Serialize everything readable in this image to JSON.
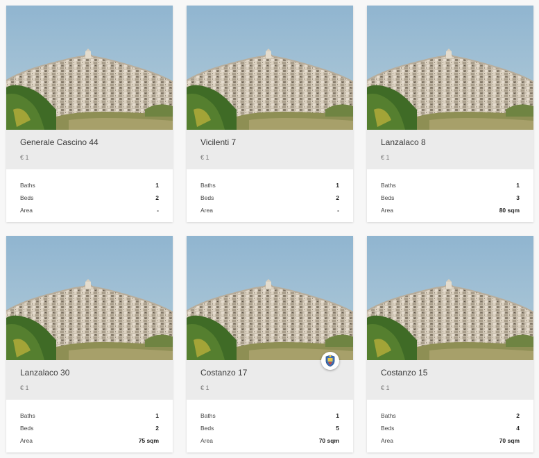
{
  "listings": [
    {
      "title": "Generale Cascino 44",
      "price": "€ 1",
      "baths_label": "Baths",
      "baths": "1",
      "beds_label": "Beds",
      "beds": "2",
      "area_label": "Area",
      "area": "-",
      "badge": false
    },
    {
      "title": "Vicilenti 7",
      "price": "€ 1",
      "baths_label": "Baths",
      "baths": "1",
      "beds_label": "Beds",
      "beds": "2",
      "area_label": "Area",
      "area": "-",
      "badge": false
    },
    {
      "title": "Lanzalaco 8",
      "price": "€ 1",
      "baths_label": "Baths",
      "baths": "1",
      "beds_label": "Beds",
      "beds": "3",
      "area_label": "Area",
      "area": "80 sqm",
      "badge": false
    },
    {
      "title": "Lanzalaco 30",
      "price": "€ 1",
      "baths_label": "Baths",
      "baths": "1",
      "beds_label": "Beds",
      "beds": "2",
      "area_label": "Area",
      "area": "75 sqm",
      "badge": false
    },
    {
      "title": "Costanzo 17",
      "price": "€ 1",
      "baths_label": "Baths",
      "baths": "1",
      "beds_label": "Beds",
      "beds": "5",
      "area_label": "Area",
      "area": "70 sqm",
      "badge": true
    },
    {
      "title": "Costanzo 15",
      "price": "€ 1",
      "baths_label": "Baths",
      "baths": "2",
      "beds_label": "Beds",
      "beds": "4",
      "area_label": "Area",
      "area": "70 sqm",
      "badge": false
    }
  ],
  "icons": {
    "photo": "hilltop-town-photo",
    "badge": "municipality-crest-icon"
  },
  "colors": {
    "sky": "#9cbdd6",
    "card_head": "#ebebeb",
    "page_bg": "#f7f7f7"
  }
}
